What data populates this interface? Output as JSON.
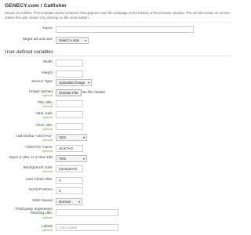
{
  "header": {
    "title": "GENECY.com / Catfisher",
    "description": "Known as Catfish. This template shows a banner that appears over the webpage at the bottom of the browser window. The ad will remain on screen unless the user closes it by clicking on the close button."
  },
  "fields": {
    "name": {
      "label": "Name",
      "value": ""
    },
    "target_size": {
      "label": "Target ad unit size",
      "value": "Select a size"
    }
  },
  "section": {
    "title": "User-defined variables"
  },
  "optional_label": "optional",
  "variables": {
    "width": {
      "label": "Width",
      "value": ""
    },
    "height": {
      "label": "Height",
      "value": ""
    },
    "source_type": {
      "label": "Source Type",
      "value": "Uploaded image"
    },
    "image_upload": {
      "label": "Image Upload",
      "button": "Choose File",
      "status": "No file chosen"
    },
    "file_url": {
      "label": "File URL",
      "value": ""
    },
    "html_code": {
      "label": "Html code",
      "value": ""
    },
    "click_url": {
      "label": "Click URL",
      "value": ""
    },
    "add_global_clicktag": {
      "label": "Add Global \"clickTAG\"",
      "value": "YES"
    },
    "clicktag_name": {
      "label": "\"clickTAG\" name",
      "value": "clickTAG"
    },
    "open_new_tab": {
      "label": "Open a URL in a New Tab",
      "value": "YES"
    },
    "background_color": {
      "label": "Background color",
      "value": "transparent"
    },
    "auto_close_after": {
      "label": "Auto Close After",
      "value": "0"
    },
    "scroll_position": {
      "label": "Scroll Position",
      "value": "0"
    },
    "slide_speed": {
      "label": "Slide Speed",
      "value": "Normal"
    },
    "third_party_url": {
      "label_line1": "Third-party Impression",
      "label_line2": "Tracking URL",
      "value": ""
    },
    "labels": {
      "label": "Labels",
      "placeholder": "Add a label"
    }
  },
  "icons": {
    "dropdown": "chevron-down-icon"
  }
}
